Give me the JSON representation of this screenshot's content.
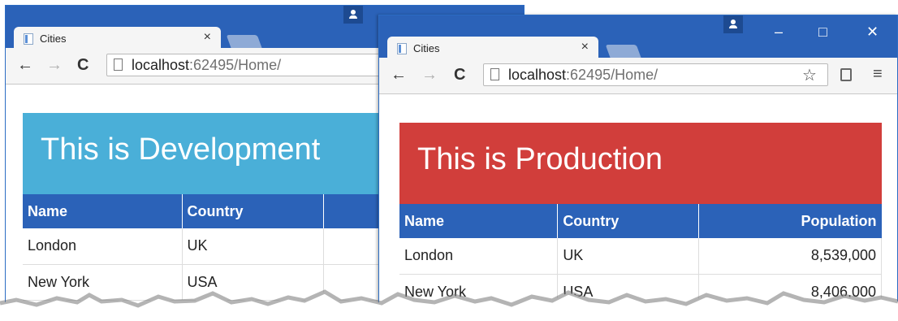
{
  "colors": {
    "titlebar": "#2b62b8",
    "dev_banner": "#4aafd8",
    "prod_banner": "#d13e3b",
    "table_header": "#2b62b8"
  },
  "back_window": {
    "tab_title": "Cities",
    "url_host": "localhost",
    "url_rest": ":62495/Home/",
    "banner_text": "This is Development",
    "table": {
      "headers": [
        "Name",
        "Country"
      ],
      "rows": [
        [
          "London",
          "UK"
        ],
        [
          "New York",
          "USA"
        ]
      ]
    }
  },
  "front_window": {
    "tab_title": "Cities",
    "url_host": "localhost",
    "url_rest": ":62495/Home/",
    "banner_text": "This is Production",
    "table": {
      "headers": [
        "Name",
        "Country",
        "Population"
      ],
      "rows": [
        [
          "London",
          "UK",
          "8,539,000"
        ],
        [
          "New York",
          "USA",
          "8,406,000"
        ]
      ]
    }
  },
  "icons": {
    "close_tab": "×",
    "back": "←",
    "forward": "→",
    "reload": "C",
    "bookmark": "☆",
    "menu": "≡",
    "minimize": "–",
    "maximize": "□",
    "close_window": "✕"
  }
}
